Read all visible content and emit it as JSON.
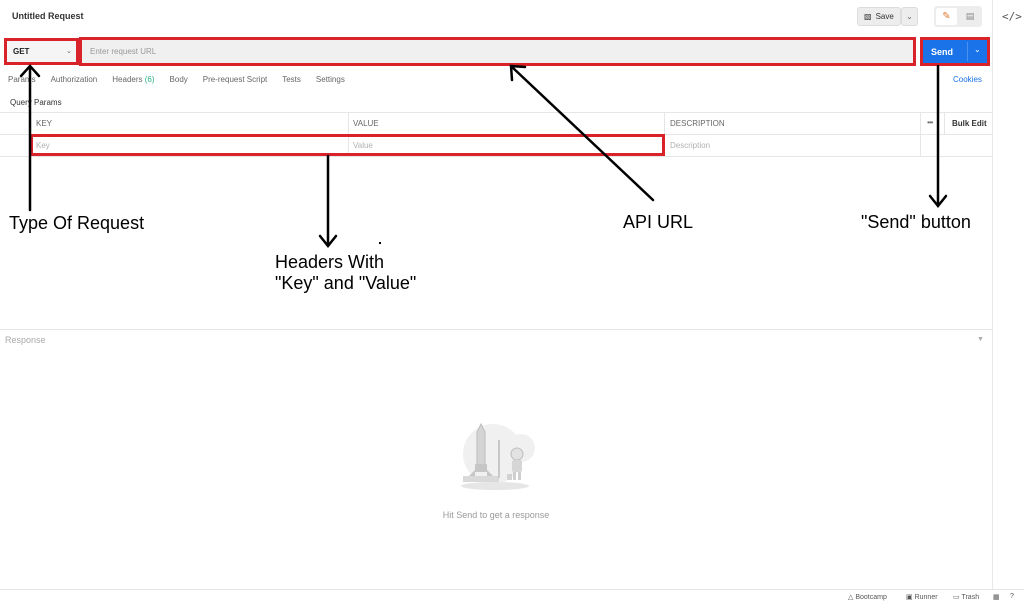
{
  "header": {
    "title": "Untitled Request",
    "save_label": "Save"
  },
  "request": {
    "method": "GET",
    "url_placeholder": "Enter request URL",
    "send_label": "Send"
  },
  "tabs": [
    {
      "label": "Params",
      "count": ""
    },
    {
      "label": "Authorization",
      "count": ""
    },
    {
      "label": "Headers",
      "count": "(6)"
    },
    {
      "label": "Body",
      "count": ""
    },
    {
      "label": "Pre-request Script",
      "count": ""
    },
    {
      "label": "Tests",
      "count": ""
    },
    {
      "label": "Settings",
      "count": ""
    }
  ],
  "cookies_label": "Cookies",
  "params": {
    "section_label": "Query Params",
    "columns": {
      "key": "KEY",
      "value": "VALUE",
      "description": "DESCRIPTION"
    },
    "placeholders": {
      "key": "Key",
      "value": "Value",
      "description": "Description"
    },
    "bulk_edit_label": "Bulk Edit"
  },
  "annotations": {
    "type_of_request": "Type Of Request",
    "headers_line1": "Headers With",
    "headers_line2": "\"Key\" and \"Value\"",
    "api_url": "API URL",
    "send_button": "\"Send\" button"
  },
  "response": {
    "label": "Response",
    "hint": "Hit Send to get a response"
  },
  "statusbar": {
    "bootcamp": "Bootcamp",
    "runner": "Runner",
    "trash": "Trash"
  },
  "colors": {
    "highlight": "#d8232a",
    "send": "#1a73e8",
    "accent_count": "#26b47f"
  }
}
